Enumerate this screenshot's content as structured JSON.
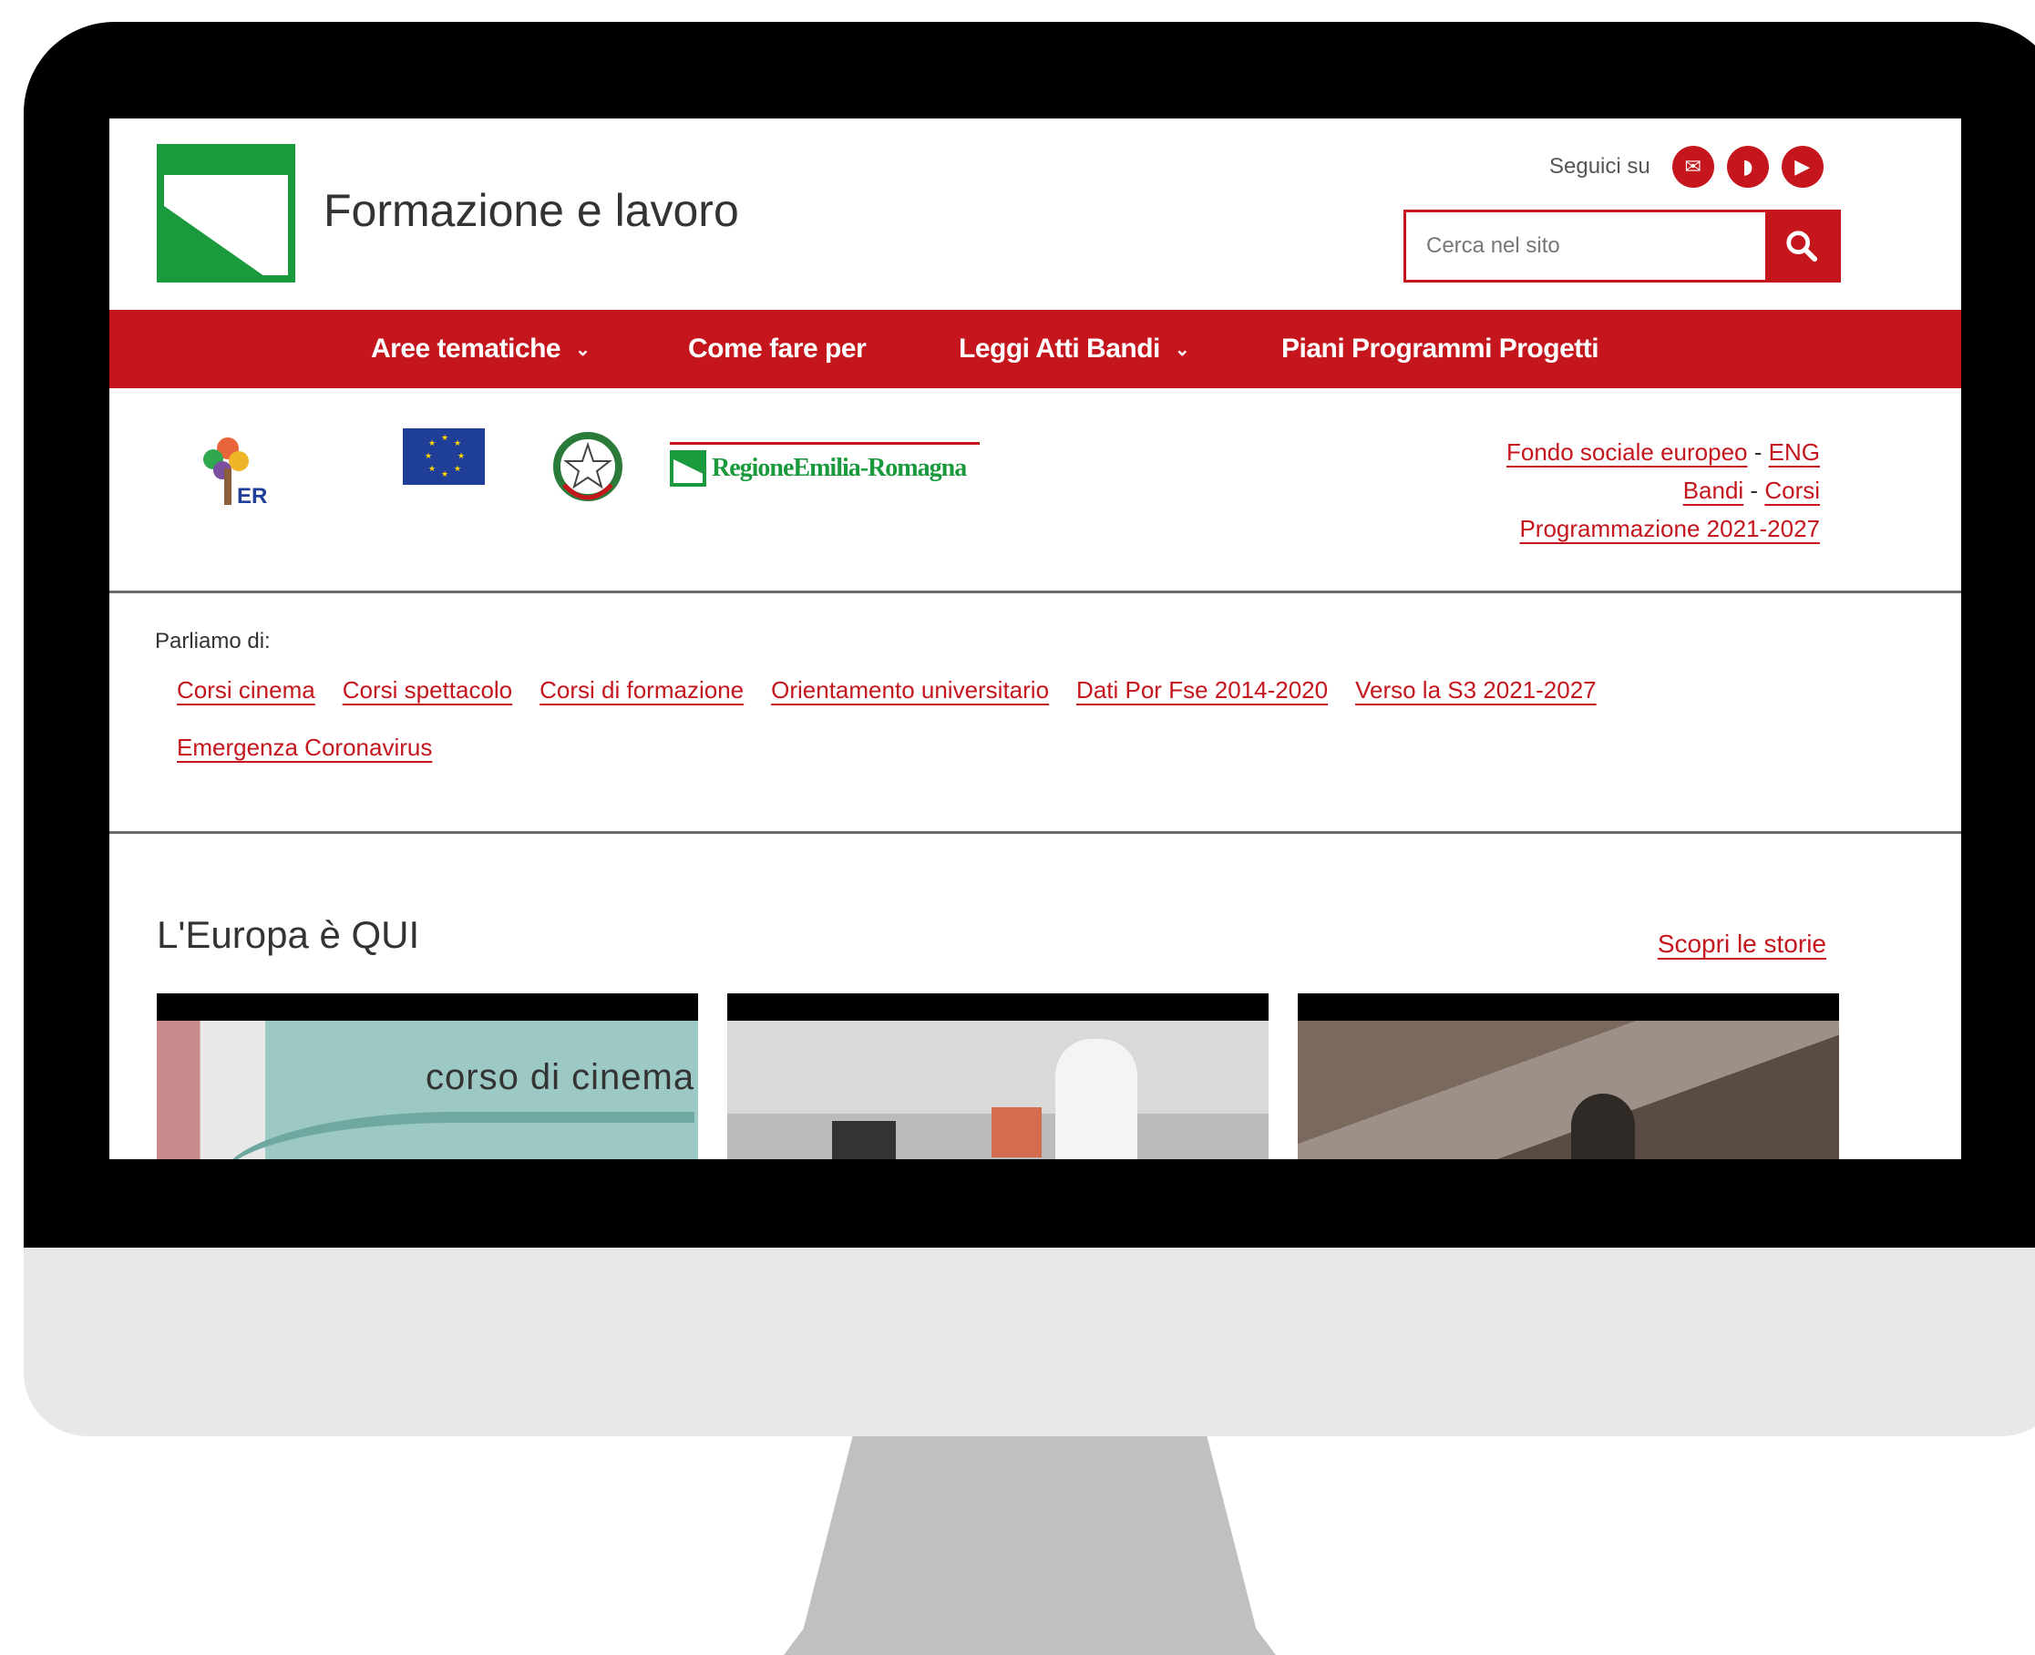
{
  "header": {
    "site_title": "Formazione e lavoro",
    "follow_label": "Seguici su",
    "social": [
      {
        "icon": "newsletter-icon",
        "glyph": "✉"
      },
      {
        "icon": "rss-icon",
        "glyph": "◗"
      },
      {
        "icon": "youtube-icon",
        "glyph": "▶"
      }
    ],
    "search_placeholder": "Cerca nel sito"
  },
  "nav": {
    "items": [
      {
        "label": "Aree tematiche",
        "has_dropdown": true
      },
      {
        "label": "Come fare per",
        "has_dropdown": false
      },
      {
        "label": "Leggi Atti Bandi",
        "has_dropdown": true
      },
      {
        "label": "Piani Programmi Progetti",
        "has_dropdown": false
      }
    ],
    "chevron": "⌄"
  },
  "sponsor_logos": {
    "er_mark": "ER",
    "rer_text": "RegioneEmilia-Romagna"
  },
  "side_links": {
    "fse": "Fondo sociale europeo",
    "eng": "ENG",
    "bandi": "Bandi",
    "corsi": "Corsi",
    "programmazione": "Programmazione 2021-2027",
    "separator": "-"
  },
  "tags": {
    "title": "Parliamo di:",
    "items": [
      "Corsi cinema",
      "Corsi spettacolo",
      "Corsi di formazione",
      "Orientamento universitario",
      "Dati Por Fse 2014-2020",
      "Verso la S3 2021-2027",
      "Emergenza Coronavirus"
    ]
  },
  "stories": {
    "title": "L'Europa è QUI",
    "link": "Scopri le storie",
    "card1_caption": "corso di cinema"
  },
  "colors": {
    "accent": "#c4161c",
    "brand_green": "#1a9a3c"
  }
}
